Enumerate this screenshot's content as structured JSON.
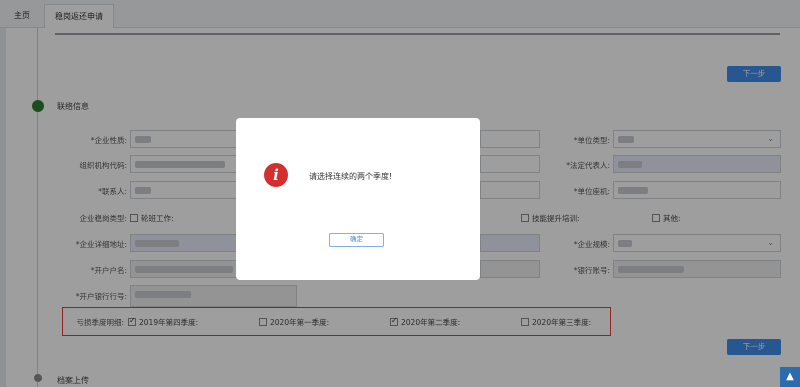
{
  "tabs": {
    "home": "主页",
    "active": "稳岗返还申请"
  },
  "buttons": {
    "next_top": "下一步",
    "next_bottom": "下一步"
  },
  "sections": {
    "contact": "联络信息",
    "archive": "档案上传"
  },
  "form": {
    "enterprise_type": "*企业性质:",
    "org_code": "组织机构代码:",
    "contact_person": "*联系人:",
    "stable_type": "企业稳岗类型:",
    "rotation_work": "轮班工作:",
    "address": "*企业详细地址:",
    "account_name": "*开户户名:",
    "bank_code": "*开户银行行号:",
    "unit_type": "*单位类型:",
    "legal_rep": "*法定代表人:",
    "unit_phone": "*单位座机:",
    "skill_training": "技能提升培训:",
    "other": "其他:",
    "scale": "*企业规模:",
    "bank_account": "*银行账号:"
  },
  "quarters": {
    "label": "亏损季度明细:",
    "items": [
      {
        "label": "2019年第四季度:",
        "checked": true
      },
      {
        "label": "2020年第一季度:",
        "checked": false
      },
      {
        "label": "2020年第二季度:",
        "checked": true
      },
      {
        "label": "2020年第三季度:",
        "checked": false
      }
    ]
  },
  "modal": {
    "icon": "info-icon",
    "message": "请选择连续的两个季度!",
    "ok": "确定"
  },
  "scroll_top_icon": "back-to-top-icon"
}
